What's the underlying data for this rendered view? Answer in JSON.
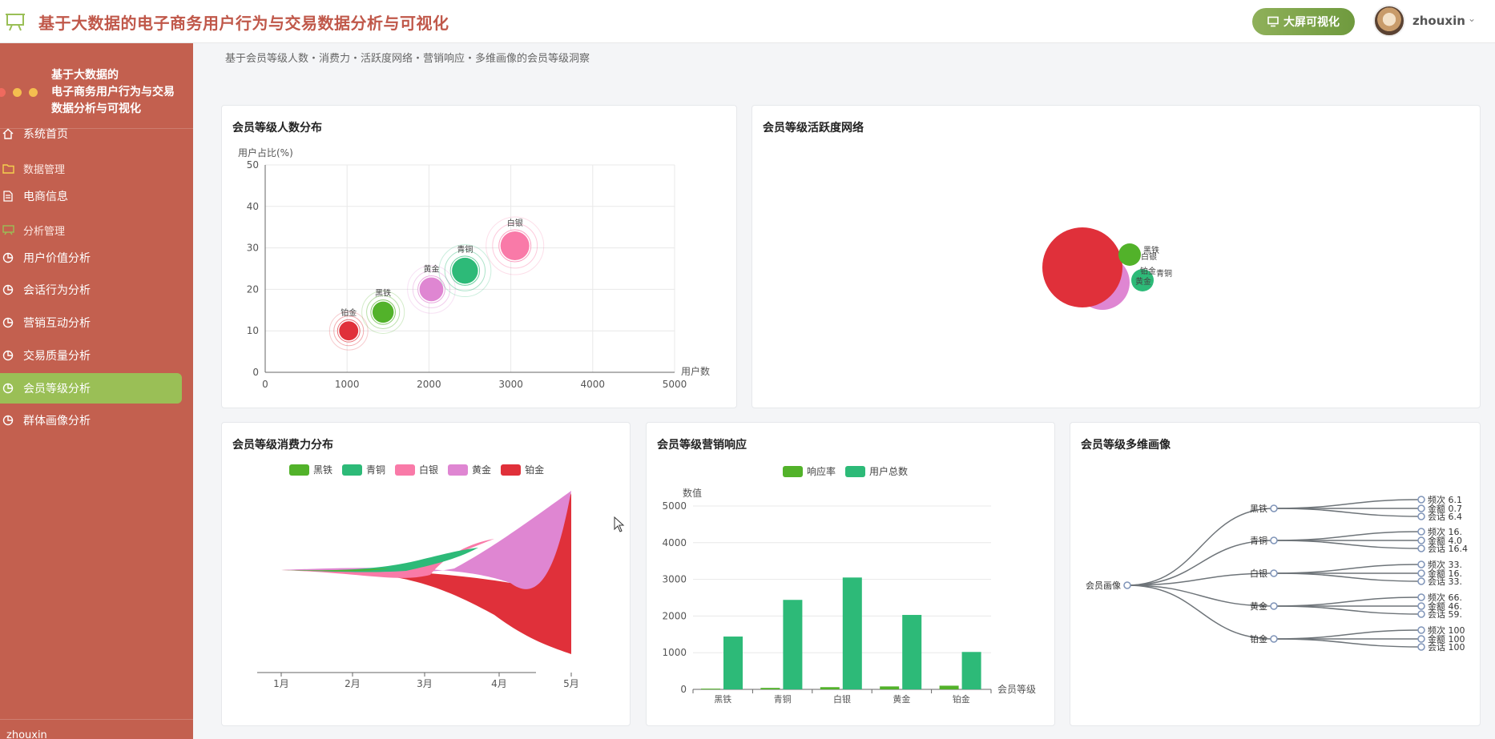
{
  "header": {
    "title": "基于大数据的电子商务用户行为与交易数据分析与可视化",
    "bigscreen_label": "大屏可视化",
    "username": "zhouxin"
  },
  "sidebar": {
    "title_lines": [
      "基于大数据的",
      "电子商务用户行为与交易",
      "数据分析与可视化"
    ],
    "items": [
      {
        "label": "系统首页",
        "icon": "home-icon",
        "type": "item"
      },
      {
        "label": "数据管理",
        "icon": "folder-icon",
        "type": "group"
      },
      {
        "label": "电商信息",
        "icon": "document-icon",
        "type": "item"
      },
      {
        "label": "分析管理",
        "icon": "screen-icon",
        "type": "group"
      },
      {
        "label": "用户价值分析",
        "icon": "pie-icon",
        "type": "item"
      },
      {
        "label": "会话行为分析",
        "icon": "pie-icon",
        "type": "item"
      },
      {
        "label": "营销互动分析",
        "icon": "pie-icon",
        "type": "item"
      },
      {
        "label": "交易质量分析",
        "icon": "pie-icon",
        "type": "item"
      },
      {
        "label": "会员等级分析",
        "icon": "pie-icon",
        "type": "item",
        "active": true
      },
      {
        "label": "群体画像分析",
        "icon": "pie-icon",
        "type": "item"
      }
    ],
    "footer_user": "zhouxin"
  },
  "page": {
    "subtitle": "基于会员等级人数・消费力・活跃度网络・营销响应・多维画像的会员等级洞察"
  },
  "colors": {
    "黑铁": "#52b22a",
    "青铜": "#2dba78",
    "白银": "#f97aa8",
    "黄金": "#df86d2",
    "铂金": "#e0303a",
    "sidebar": "#c3604f",
    "active": "#9abf56"
  },
  "cards": {
    "bubble": {
      "title": "会员等级人数分布"
    },
    "network": {
      "title": "会员等级活跃度网络"
    },
    "stream": {
      "title": "会员等级消费力分布"
    },
    "bars": {
      "title": "会员等级营销响应"
    },
    "tree": {
      "title": "会员等级多维画像"
    }
  },
  "chart_data": [
    {
      "type": "scatter",
      "title": "会员等级人数分布",
      "xlabel": "用户数",
      "ylabel": "用户占比(%)",
      "xlim": [
        0,
        5000
      ],
      "ylim": [
        0,
        50
      ],
      "xticks": [
        0,
        1000,
        2000,
        3000,
        4000,
        5000
      ],
      "yticks": [
        0,
        10,
        20,
        30,
        40,
        50
      ],
      "points": [
        {
          "label": "铂金",
          "x": 1020,
          "y": 10
        },
        {
          "label": "黑铁",
          "x": 1440,
          "y": 14.5
        },
        {
          "label": "黄金",
          "x": 2030,
          "y": 20
        },
        {
          "label": "青铜",
          "x": 2440,
          "y": 24.5
        },
        {
          "label": "白银",
          "x": 3050,
          "y": 30.5
        }
      ]
    },
    {
      "type": "network",
      "title": "会员等级活跃度网络",
      "nodes": [
        {
          "label": "铂金",
          "size": 50
        },
        {
          "label": "黄金",
          "size": 34
        },
        {
          "label": "白银",
          "size": 26
        },
        {
          "label": "黑铁",
          "size": 14
        },
        {
          "label": "青铜",
          "size": 14
        }
      ]
    },
    {
      "type": "area",
      "title": "会员等级消费力分布",
      "categories": [
        "1月",
        "2月",
        "3月",
        "4月",
        "5月"
      ],
      "series": [
        {
          "name": "黑铁"
        },
        {
          "name": "青铜"
        },
        {
          "name": "白银"
        },
        {
          "name": "黄金"
        },
        {
          "name": "铂金"
        }
      ]
    },
    {
      "type": "bar",
      "title": "会员等级营销响应",
      "categories": [
        "黑铁",
        "青铜",
        "白银",
        "黄金",
        "铂金"
      ],
      "xlabel": "会员等级",
      "ylabel": "数值",
      "ylim": [
        0,
        5000
      ],
      "yticks": [
        0,
        1000,
        2000,
        3000,
        4000,
        5000
      ],
      "series": [
        {
          "name": "响应率",
          "values": [
            20,
            40,
            60,
            80,
            100
          ]
        },
        {
          "name": "用户总数",
          "values": [
            1440,
            2440,
            3050,
            2030,
            1020
          ]
        }
      ]
    },
    {
      "type": "tree",
      "title": "会员等级多维画像",
      "root": "会员画像",
      "children": [
        {
          "name": "黑铁",
          "leaves": [
            "频次 6.1",
            "金额 0.7",
            "会话 6.4"
          ]
        },
        {
          "name": "青铜",
          "leaves": [
            "频次 16.",
            "金额 4.0",
            "会话 16.4"
          ]
        },
        {
          "name": "白银",
          "leaves": [
            "频次 33.",
            "金额 16.",
            "会话 33."
          ]
        },
        {
          "name": "黄金",
          "leaves": [
            "频次 66.",
            "金额 46.",
            "会话 59."
          ]
        },
        {
          "name": "铂金",
          "leaves": [
            "频次 100",
            "金额 100",
            "会话 100"
          ]
        }
      ]
    }
  ]
}
